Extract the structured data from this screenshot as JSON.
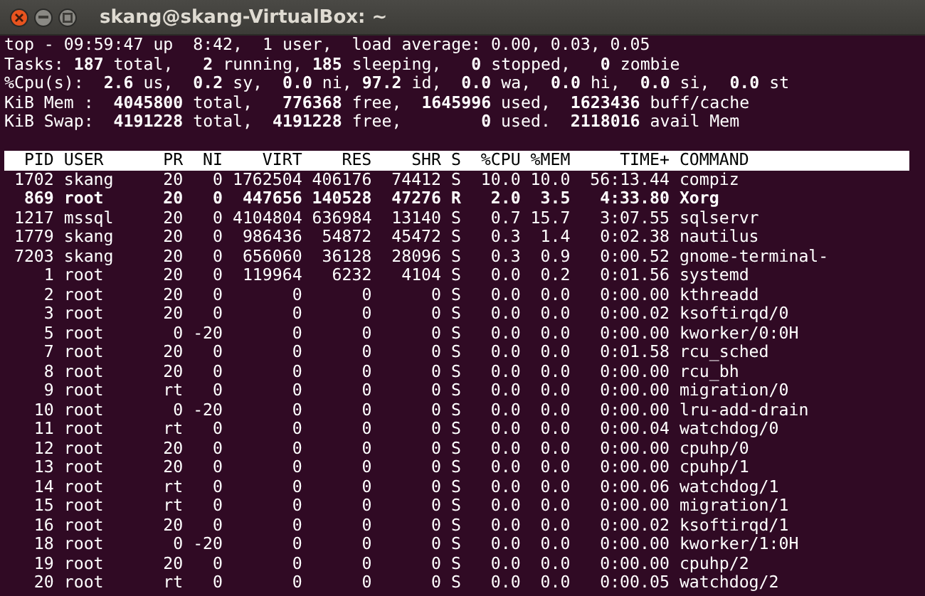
{
  "window": {
    "title": "skang@skang-VirtualBox: ~"
  },
  "summary": [
    "top - 09:59:47 up  8:42,  1 user,  load average: 0.00, 0.03, 0.05",
    "Tasks: **187** total,   **2** running, **185** sleeping,   **0** stopped,   **0** zombie",
    "%Cpu(s):  **2.6** us,  **0.2** sy,  **0.0** ni, **97.2** id,  **0.0** wa,  **0.0** hi,  **0.0** si,  **0.0** st",
    "KiB Mem :  **4045800** total,   **776368** free,  **1645996** used,  **1623436** buff/cache",
    "KiB Swap:  **4191228** total,  **4191228** free,        **0** used.  **2118016** avail Mem"
  ],
  "table": {
    "columns": [
      "PID",
      "USER",
      "PR",
      "NI",
      "VIRT",
      "RES",
      "SHR",
      "S",
      "%CPU",
      "%MEM",
      "TIME+",
      "COMMAND"
    ],
    "rows": [
      {
        "highlighted": false,
        "cells": [
          "1702",
          "skang",
          "20",
          "0",
          "1762504",
          "406176",
          "74412",
          "S",
          "10.0",
          "10.0",
          "56:13.44",
          "compiz"
        ]
      },
      {
        "highlighted": true,
        "cells": [
          "869",
          "root",
          "20",
          "0",
          "447656",
          "140528",
          "47276",
          "R",
          "2.0",
          "3.5",
          "4:33.80",
          "Xorg"
        ]
      },
      {
        "highlighted": false,
        "cells": [
          "1217",
          "mssql",
          "20",
          "0",
          "4104804",
          "636984",
          "13140",
          "S",
          "0.7",
          "15.7",
          "3:07.55",
          "sqlservr"
        ]
      },
      {
        "highlighted": false,
        "cells": [
          "1779",
          "skang",
          "20",
          "0",
          "986436",
          "54872",
          "45472",
          "S",
          "0.3",
          "1.4",
          "0:02.38",
          "nautilus"
        ]
      },
      {
        "highlighted": false,
        "cells": [
          "7203",
          "skang",
          "20",
          "0",
          "656060",
          "36128",
          "28096",
          "S",
          "0.3",
          "0.9",
          "0:00.52",
          "gnome-terminal-"
        ]
      },
      {
        "highlighted": false,
        "cells": [
          "1",
          "root",
          "20",
          "0",
          "119964",
          "6232",
          "4104",
          "S",
          "0.0",
          "0.2",
          "0:01.56",
          "systemd"
        ]
      },
      {
        "highlighted": false,
        "cells": [
          "2",
          "root",
          "20",
          "0",
          "0",
          "0",
          "0",
          "S",
          "0.0",
          "0.0",
          "0:00.00",
          "kthreadd"
        ]
      },
      {
        "highlighted": false,
        "cells": [
          "3",
          "root",
          "20",
          "0",
          "0",
          "0",
          "0",
          "S",
          "0.0",
          "0.0",
          "0:00.02",
          "ksoftirqd/0"
        ]
      },
      {
        "highlighted": false,
        "cells": [
          "5",
          "root",
          "0",
          "-20",
          "0",
          "0",
          "0",
          "S",
          "0.0",
          "0.0",
          "0:00.00",
          "kworker/0:0H"
        ]
      },
      {
        "highlighted": false,
        "cells": [
          "7",
          "root",
          "20",
          "0",
          "0",
          "0",
          "0",
          "S",
          "0.0",
          "0.0",
          "0:01.58",
          "rcu_sched"
        ]
      },
      {
        "highlighted": false,
        "cells": [
          "8",
          "root",
          "20",
          "0",
          "0",
          "0",
          "0",
          "S",
          "0.0",
          "0.0",
          "0:00.00",
          "rcu_bh"
        ]
      },
      {
        "highlighted": false,
        "cells": [
          "9",
          "root",
          "rt",
          "0",
          "0",
          "0",
          "0",
          "S",
          "0.0",
          "0.0",
          "0:00.00",
          "migration/0"
        ]
      },
      {
        "highlighted": false,
        "cells": [
          "10",
          "root",
          "0",
          "-20",
          "0",
          "0",
          "0",
          "S",
          "0.0",
          "0.0",
          "0:00.00",
          "lru-add-drain"
        ]
      },
      {
        "highlighted": false,
        "cells": [
          "11",
          "root",
          "rt",
          "0",
          "0",
          "0",
          "0",
          "S",
          "0.0",
          "0.0",
          "0:00.04",
          "watchdog/0"
        ]
      },
      {
        "highlighted": false,
        "cells": [
          "12",
          "root",
          "20",
          "0",
          "0",
          "0",
          "0",
          "S",
          "0.0",
          "0.0",
          "0:00.00",
          "cpuhp/0"
        ]
      },
      {
        "highlighted": false,
        "cells": [
          "13",
          "root",
          "20",
          "0",
          "0",
          "0",
          "0",
          "S",
          "0.0",
          "0.0",
          "0:00.00",
          "cpuhp/1"
        ]
      },
      {
        "highlighted": false,
        "cells": [
          "14",
          "root",
          "rt",
          "0",
          "0",
          "0",
          "0",
          "S",
          "0.0",
          "0.0",
          "0:00.06",
          "watchdog/1"
        ]
      },
      {
        "highlighted": false,
        "cells": [
          "15",
          "root",
          "rt",
          "0",
          "0",
          "0",
          "0",
          "S",
          "0.0",
          "0.0",
          "0:00.00",
          "migration/1"
        ]
      },
      {
        "highlighted": false,
        "cells": [
          "16",
          "root",
          "20",
          "0",
          "0",
          "0",
          "0",
          "S",
          "0.0",
          "0.0",
          "0:00.02",
          "ksoftirqd/1"
        ]
      },
      {
        "highlighted": false,
        "cells": [
          "18",
          "root",
          "0",
          "-20",
          "0",
          "0",
          "0",
          "S",
          "0.0",
          "0.0",
          "0:00.00",
          "kworker/1:0H"
        ]
      },
      {
        "highlighted": false,
        "cells": [
          "19",
          "root",
          "20",
          "0",
          "0",
          "0",
          "0",
          "S",
          "0.0",
          "0.0",
          "0:00.00",
          "cpuhp/2"
        ]
      },
      {
        "highlighted": false,
        "cells": [
          "20",
          "root",
          "rt",
          "0",
          "0",
          "0",
          "0",
          "S",
          "0.0",
          "0.0",
          "0:00.05",
          "watchdog/2"
        ]
      }
    ]
  }
}
